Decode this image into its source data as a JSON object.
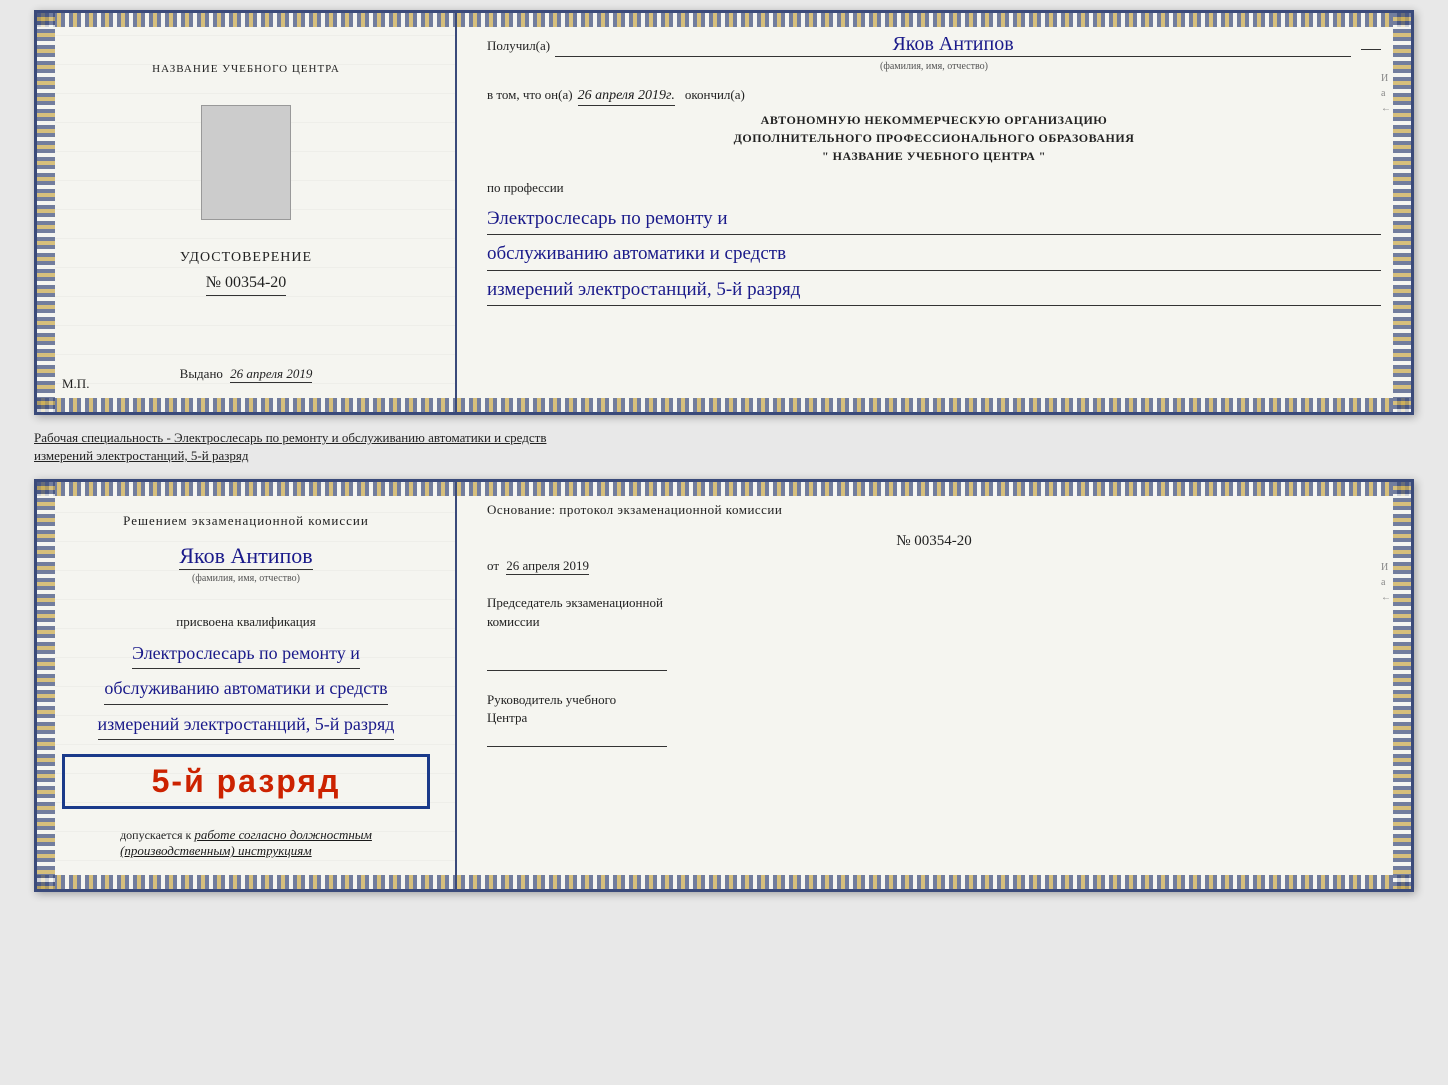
{
  "top_doc": {
    "left": {
      "org_name": "НАЗВАНИЕ УЧЕБНОГО ЦЕНТРА",
      "udostoverenie_title": "УДОСТОВЕРЕНИЕ",
      "number": "№ 00354-20",
      "vydano_label": "Выдано",
      "vydano_date": "26 апреля 2019",
      "mp_label": "М.П."
    },
    "right": {
      "poluchil_label": "Получил(а)",
      "recipient_name": "Яков Антипов",
      "fio_subtitle": "(фамилия, имя, отчество)",
      "vtom_label": "в том, что он(а)",
      "vtom_date": "26 апреля 2019г.",
      "okonchil_label": "окончил(а)",
      "org_line1": "АВТОНОМНУЮ НЕКОММЕРЧЕСКУЮ ОРГАНИЗАЦИЮ",
      "org_line2": "ДОПОЛНИТЕЛЬНОГО ПРОФЕССИОНАЛЬНОГО ОБРАЗОВАНИЯ",
      "org_line3": "\"  НАЗВАНИЕ УЧЕБНОГО ЦЕНТРА  \"",
      "po_professii": "по профессии",
      "profession_line1": "Электрослесарь по ремонту и",
      "profession_line2": "обслуживанию автоматики и средств",
      "profession_line3": "измерений электростанций, 5-й разряд"
    }
  },
  "between_text": {
    "line1": "Рабочая специальность - Электрослесарь по ремонту и обслуживанию автоматики и средств",
    "line2": "измерений электростанций, 5-й разряд"
  },
  "bottom_doc": {
    "left": {
      "resheniem_title": "Решением экзаменационной комиссии",
      "name": "Яков Антипов",
      "fio_subtitle": "(фамилия, имя, отчество)",
      "prisvoena_label": "присвоена квалификация",
      "profession_line1": "Электрослесарь по ремонту и",
      "profession_line2": "обслуживанию автоматики и средств",
      "profession_line3": "измерений электростанций, 5-й разряд",
      "razryad_big": "5-й разряд",
      "dopuskaetsya_label": "допускается к",
      "dopuskaetsya_text": "работе согласно должностным",
      "dopuskaetsya_text2": "(производственным) инструкциям"
    },
    "right": {
      "osnovanie_label": "Основание: протокол экзаменационной комиссии",
      "number": "№  00354-20",
      "ot_label": "от",
      "ot_date": "26 апреля 2019",
      "predsedatel_label": "Председатель экзаменационной",
      "predsedatel_label2": "комиссии",
      "rukovoditel_label": "Руководитель учебного",
      "rukovoditel_label2": "Центра"
    }
  },
  "deco": {
    "right_side_chars": [
      "И",
      "а",
      "←"
    ]
  }
}
